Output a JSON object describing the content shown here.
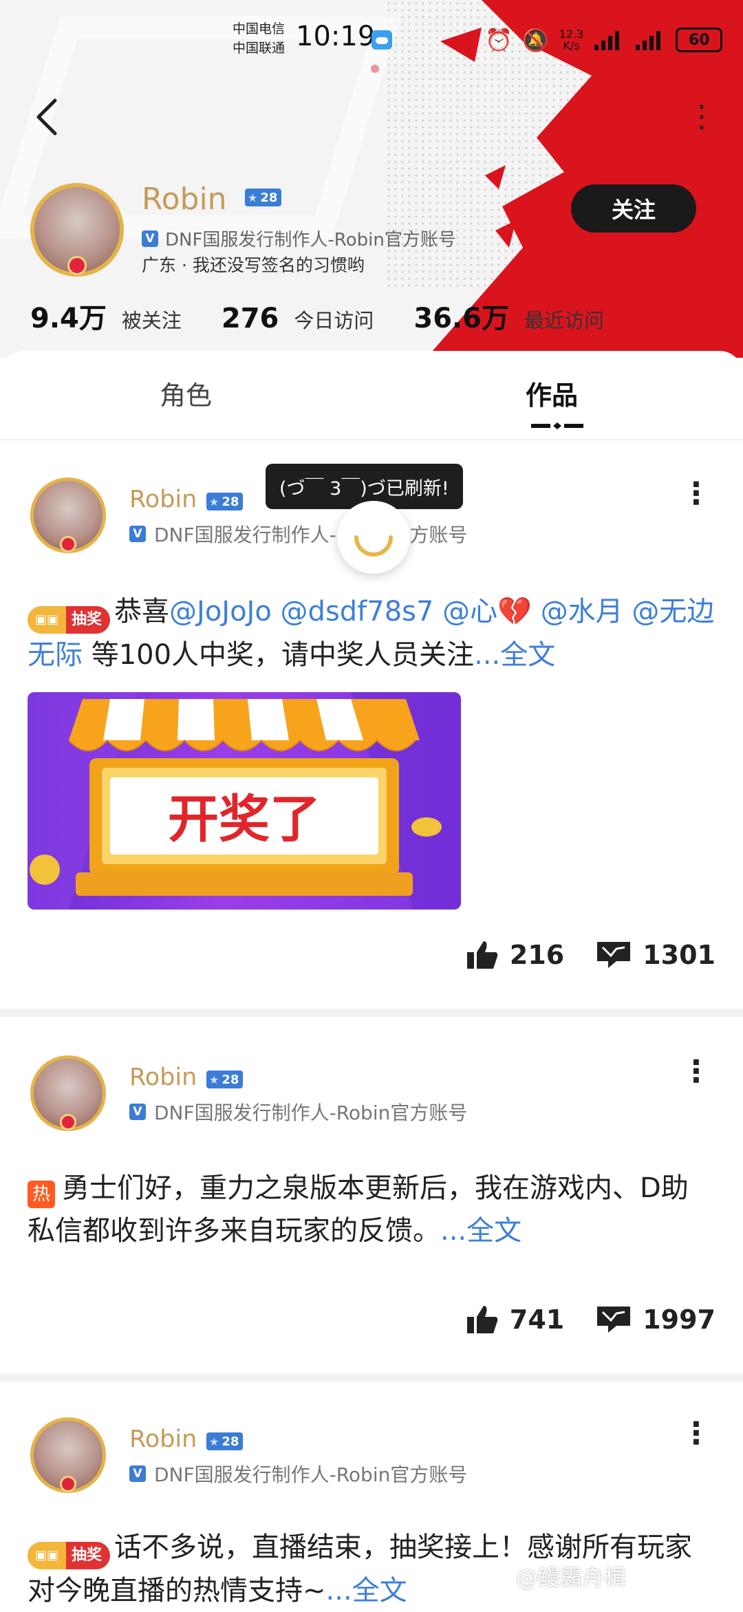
{
  "status_bar": {
    "carrier_1": "中国电信",
    "carrier_2": "中国联通",
    "time": "10:19",
    "net_speed_value": "12.3",
    "net_speed_unit": "K/s",
    "battery": "60"
  },
  "header": {
    "name": "Robin",
    "level": "28",
    "verify_text": "DNF国服发行制作人-Robin官方账号",
    "bio": "广东 · 我还没写签名的习惯哟",
    "follow_label": "关注",
    "stats": [
      {
        "value": "9.4万",
        "label": "被关注"
      },
      {
        "value": "276",
        "label": "今日访问"
      },
      {
        "value": "36.6万",
        "label": "最近访问"
      }
    ]
  },
  "tabs": [
    {
      "label": "角色",
      "active": false
    },
    {
      "label": "作品",
      "active": true
    }
  ],
  "toast": "(づ￣ 3￣)づ已刷新!",
  "posts": [
    {
      "author": "Robin",
      "level": "28",
      "verify_text": "DNF国服发行制作人-Robin官方账号",
      "tag": "抽奖",
      "text_parts": {
        "pre": "恭喜",
        "mention_1": "@JoJoJo",
        "mention_2": "@dsdf78s7",
        "mention_3": "@心💔",
        "mention_4": "@水月",
        "mention_5": "@无边无际",
        "post": " 等100人中奖，请中奖人员关注",
        "more": "...全文"
      },
      "image_text": "开奖了",
      "likes": "216",
      "comments": "1301"
    },
    {
      "author": "Robin",
      "level": "28",
      "verify_text": "DNF国服发行制作人-Robin官方账号",
      "tag": "热",
      "text": "勇士们好，重力之泉版本更新后，我在游戏内、D助私信都收到许多来自玩家的反馈。",
      "more": "...全文",
      "likes": "741",
      "comments": "1997"
    },
    {
      "author": "Robin",
      "level": "28",
      "verify_text": "DNF国服发行制作人-Robin官方账号",
      "tag": "抽奖",
      "text": "话不多说，直播结束，抽奖接上！感谢所有玩家对今晚直播的热情支持~",
      "more": "...全文"
    }
  ],
  "watermark": "@鳗霸舟楫",
  "colors": {
    "accent_blue": "#3d7fd9",
    "name_gold": "#c69a58",
    "brand_red": "#d9141d",
    "follow_bg": "#1a1a1a"
  }
}
